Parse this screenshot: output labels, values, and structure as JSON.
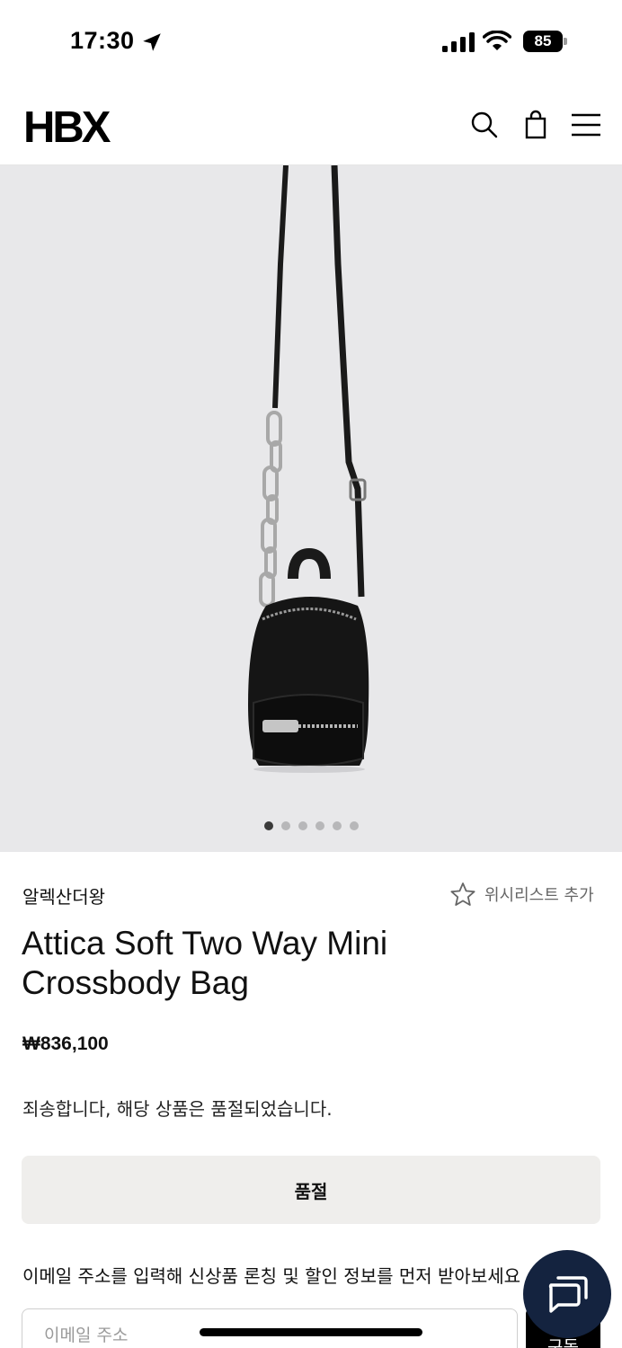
{
  "status_bar": {
    "time": "17:30",
    "battery": "85"
  },
  "header": {
    "logo": "HBX"
  },
  "gallery": {
    "total_images": 6,
    "active_index": 0
  },
  "product": {
    "brand": "알렉산더왕",
    "wishlist_label": "위시리스트 추가",
    "title": "Attica Soft Two Way Mini Crossbody Bag",
    "price": "₩836,100",
    "soldout_message": "죄송합니다, 해당 상품은 품절되었습니다.",
    "soldout_button": "품절"
  },
  "newsletter": {
    "text": "이메일 주소를 입력해 신상품 론칭 및 할인 정보를 먼저 받아보세요",
    "placeholder": "이메일 주소",
    "button": "구독"
  },
  "colors": {
    "gallery_bg": "#e8e8ea",
    "chat_fab": "#14233f",
    "soldout_bg": "#efeeec"
  }
}
